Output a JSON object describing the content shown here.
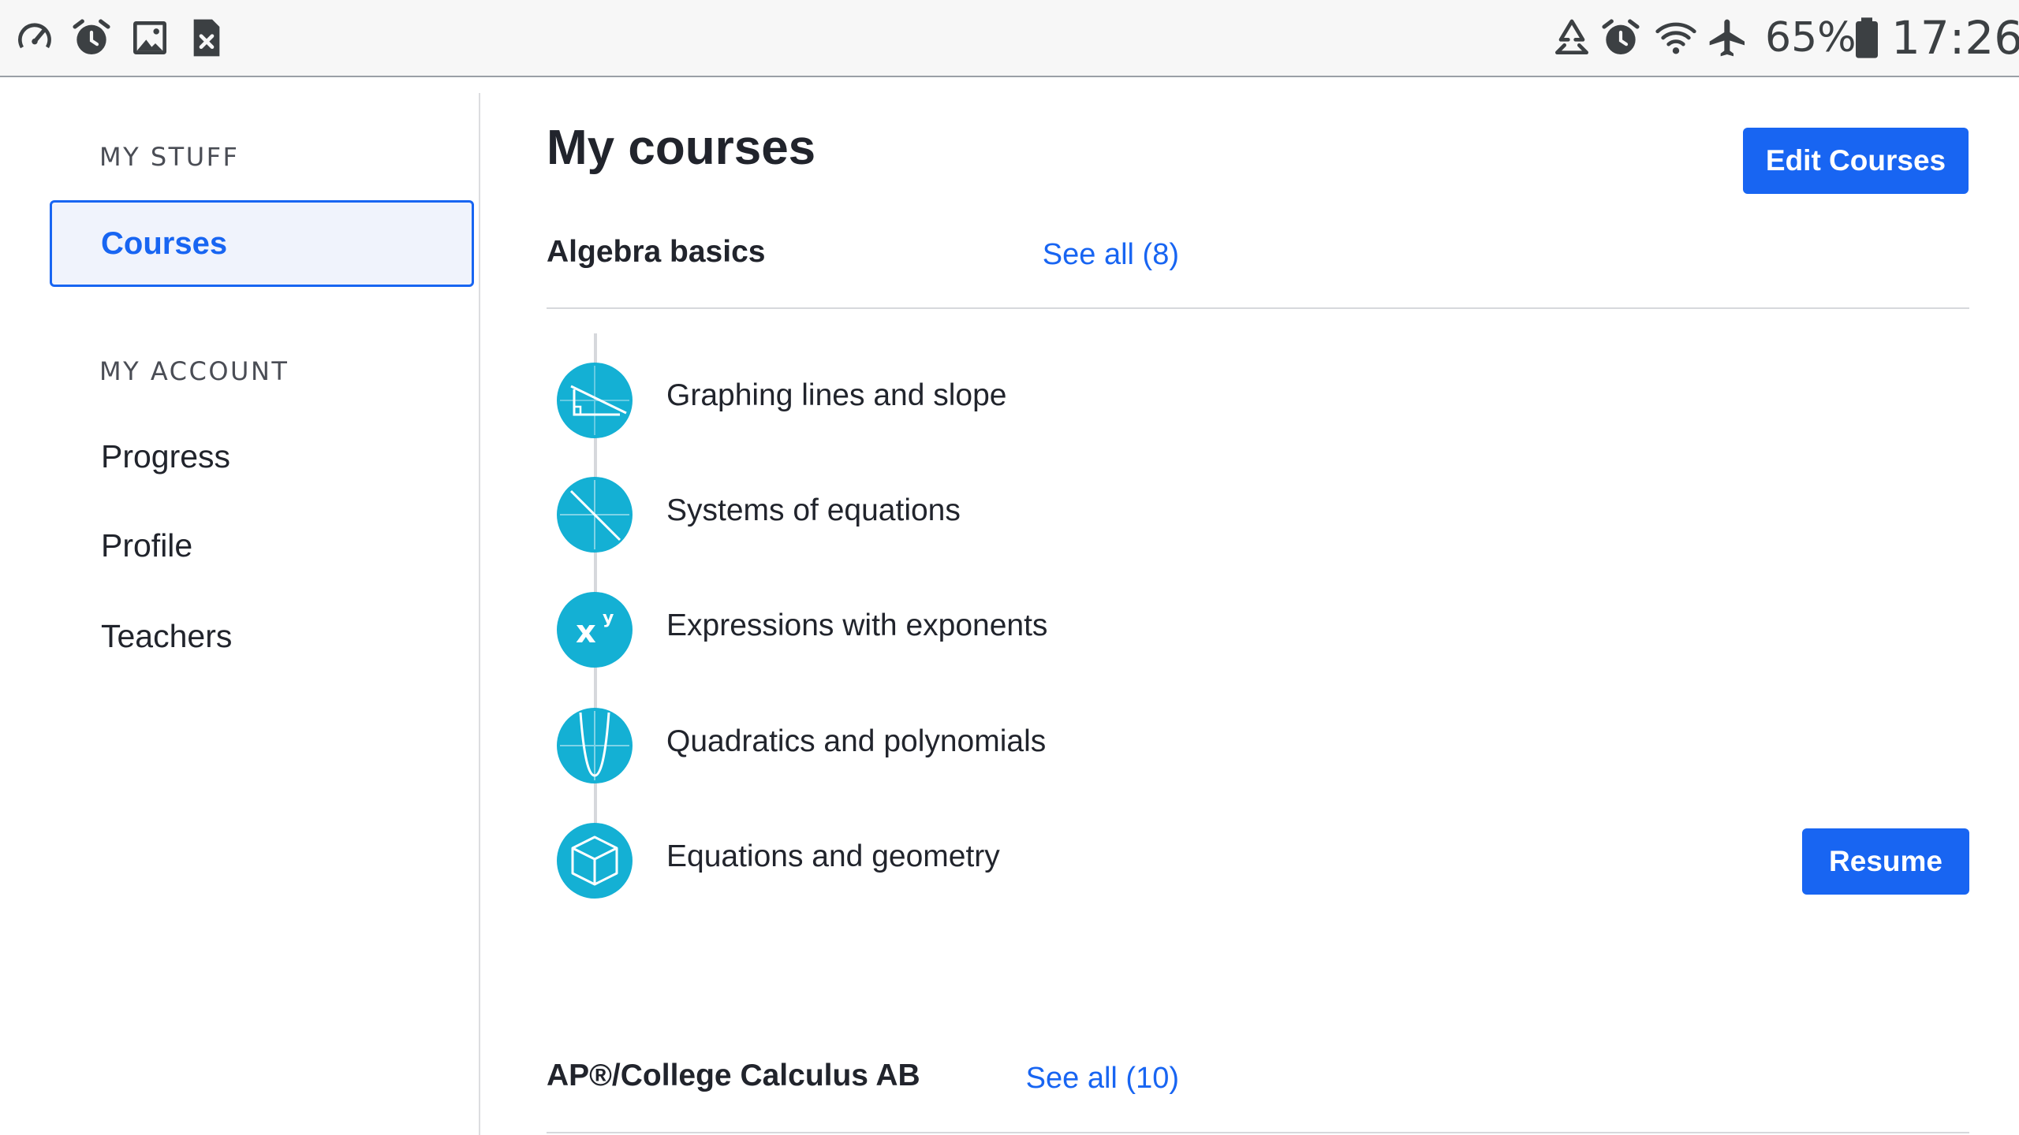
{
  "status_bar": {
    "left_icons": [
      "speedometer-icon",
      "alarm-icon",
      "image-icon",
      "close-file-icon"
    ],
    "right_icons": [
      "recycle-icon",
      "alarm-icon",
      "wifi-icon",
      "airplane-icon",
      "battery-icon"
    ],
    "battery": "65%",
    "time": "17:26"
  },
  "sidebar": {
    "my_stuff_heading": "MY STUFF",
    "courses_label": "Courses",
    "my_account_heading": "MY ACCOUNT",
    "items": [
      {
        "label": "Progress"
      },
      {
        "label": "Profile"
      },
      {
        "label": "Teachers"
      }
    ]
  },
  "main": {
    "title": "My courses",
    "edit_button": "Edit Courses",
    "sections": [
      {
        "title": "Algebra basics",
        "see_all": "See all (8)",
        "units": [
          {
            "label": "Graphing lines and slope",
            "icon": "graphing-lines-icon"
          },
          {
            "label": "Systems of equations",
            "icon": "systems-equations-icon"
          },
          {
            "label": "Expressions with exponents",
            "icon": "exponents-icon"
          },
          {
            "label": "Quadratics and polynomials",
            "icon": "parabola-icon"
          },
          {
            "label": "Equations and geometry",
            "icon": "cube-icon"
          }
        ],
        "resume_button": "Resume"
      },
      {
        "title": "AP®/College Calculus AB",
        "see_all": "See all (10)"
      }
    ]
  },
  "colors": {
    "accent": "#1865f2",
    "unit_icon": "#14b0d4",
    "text": "#21242c"
  }
}
